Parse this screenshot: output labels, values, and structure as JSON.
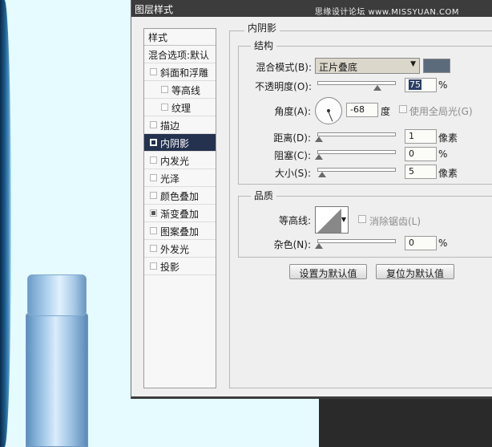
{
  "dialog": {
    "title": "图层样式",
    "watermark": "思缘设计论坛  www.MISSYUAN.COM"
  },
  "sidebar": {
    "header": "样式",
    "items": [
      {
        "label": "混合选项:默认",
        "type": "blend"
      },
      {
        "label": "斜面和浮雕",
        "checked": false
      },
      {
        "label": "等高线",
        "checked": false,
        "indent": true
      },
      {
        "label": "纹理",
        "checked": false,
        "indent": true
      },
      {
        "label": "描边",
        "checked": false
      },
      {
        "label": "内阴影",
        "checked": true,
        "selected": true
      },
      {
        "label": "内发光",
        "checked": false
      },
      {
        "label": "光泽",
        "checked": false
      },
      {
        "label": "颜色叠加",
        "checked": false
      },
      {
        "label": "渐变叠加",
        "checked": true
      },
      {
        "label": "图案叠加",
        "checked": false
      },
      {
        "label": "外发光",
        "checked": false
      },
      {
        "label": "投影",
        "checked": false
      }
    ]
  },
  "panel": {
    "title": "内阴影",
    "structure": {
      "title": "结构",
      "blend_mode_label": "混合模式(B):",
      "blend_mode_value": "正片叠底",
      "shadow_color": "#5c6b7c",
      "opacity_label": "不透明度(O):",
      "opacity_value": "75",
      "opacity_unit": "%",
      "opacity_level": 0.75,
      "angle_label": "角度(A):",
      "angle_value": "-68",
      "angle_unit": "度",
      "global_light_label": "使用全局光(G)",
      "global_light_checked": false,
      "distance_label": "距离(D):",
      "distance_value": "1",
      "distance_unit": "像素",
      "choke_label": "阻塞(C):",
      "choke_value": "0",
      "choke_unit": "%",
      "size_label": "大小(S):",
      "size_value": "5",
      "size_unit": "像素"
    },
    "quality": {
      "title": "品质",
      "contour_label": "等高线:",
      "antialias_label": "消除锯齿(L)",
      "antialias_checked": false,
      "noise_label": "杂色(N):",
      "noise_value": "0",
      "noise_unit": "%"
    },
    "buttons": {
      "make_default": "设置为默认值",
      "reset_default": "复位为默认值"
    }
  }
}
